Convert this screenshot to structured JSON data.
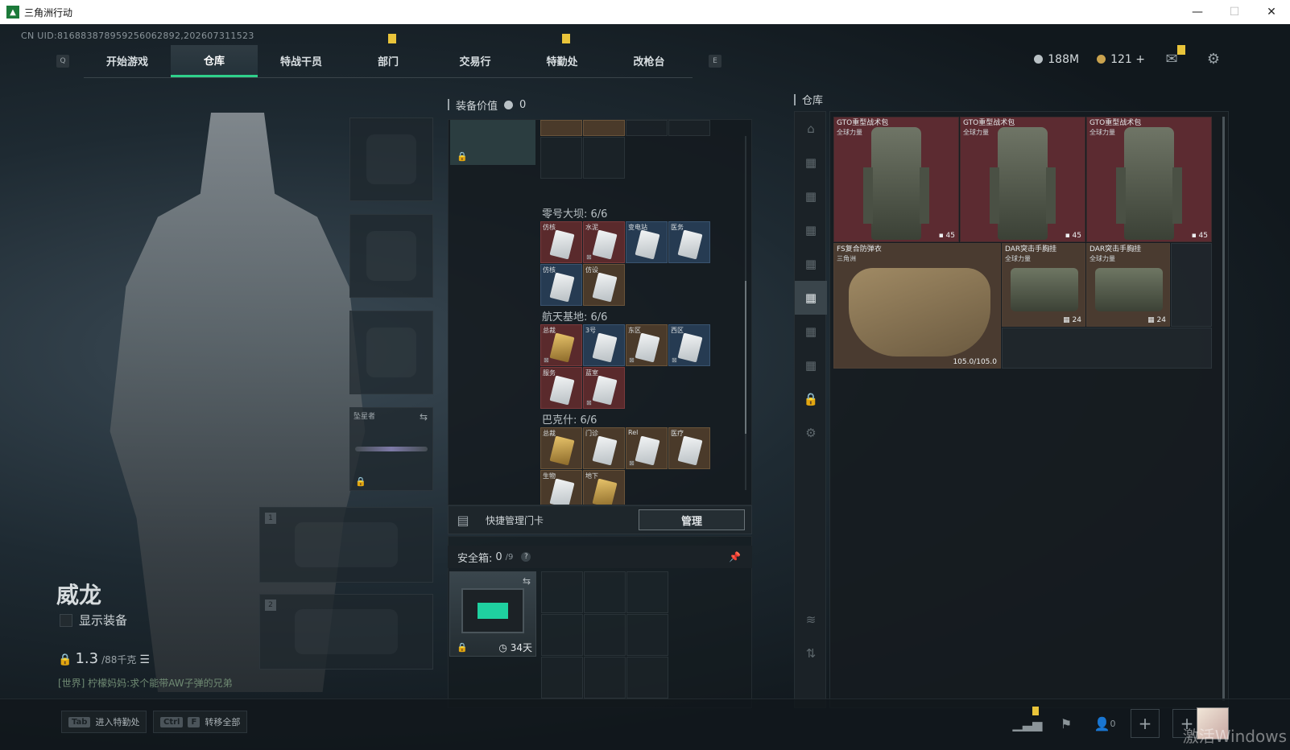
{
  "window": {
    "title": "三角洲行动",
    "minimize": "—",
    "maximize": "☐",
    "close": "✕"
  },
  "uid": "CN UID:816883878959256062892,202607311523",
  "nav": {
    "left_key": "Q",
    "right_key": "E",
    "tabs": [
      {
        "label": "开始游戏"
      },
      {
        "label": "仓库"
      },
      {
        "label": "特战干员"
      },
      {
        "label": "部门"
      },
      {
        "label": "交易行"
      },
      {
        "label": "特勤处"
      },
      {
        "label": "改枪台"
      }
    ]
  },
  "currency": {
    "silver": "188M",
    "gold": "121",
    "gold_plus": "+"
  },
  "operator": {
    "name": "威龙",
    "show_equipment": "显示装备",
    "weight": "1.3",
    "weight_cap": "/88千克",
    "world_chat": "[世界] 柠檬妈妈:求个能带AW子弹的兄弟"
  },
  "slots": {
    "melee_label": "坠星者",
    "primary_num": "1",
    "secondary_num": "2"
  },
  "mid": {
    "equip_value_label": "装备价值",
    "equip_value": "0",
    "sections": [
      {
        "title": "零号大坝: 6/6",
        "cards": [
          {
            "name": "仿核",
            "color": "red"
          },
          {
            "name": "水泥",
            "color": "red"
          },
          {
            "name": "变电站",
            "color": "blue"
          },
          {
            "name": "医务",
            "color": "blue"
          },
          {
            "name": "仿核",
            "color": "blue"
          },
          {
            "name": "仿设",
            "color": "brown"
          }
        ]
      },
      {
        "title": "航天基地: 6/6",
        "cards": [
          {
            "name": "总裁",
            "color": "red"
          },
          {
            "name": "3号",
            "color": "blue"
          },
          {
            "name": "东区",
            "color": "brown"
          },
          {
            "name": "西区",
            "color": "blue"
          },
          {
            "name": "服务",
            "color": "red"
          },
          {
            "name": "蓝室",
            "color": "red"
          }
        ]
      },
      {
        "title": "巴克什: 6/6",
        "cards": [
          {
            "name": "总裁",
            "color": "brown"
          },
          {
            "name": "门诊",
            "color": "brown"
          },
          {
            "name": "Rel",
            "color": "brown"
          },
          {
            "name": "医疗",
            "color": "brown"
          },
          {
            "name": "生物",
            "color": "brown"
          },
          {
            "name": "地下",
            "color": "brown"
          }
        ]
      }
    ],
    "quick_card_label": "快捷管理门卡",
    "manage_button": "管理",
    "safe_label": "安全箱:",
    "safe_count": "0",
    "safe_cap": "/9",
    "safe_help": "?",
    "safe_days": "34天"
  },
  "warehouse": {
    "title": "仓库",
    "items": [
      {
        "name": "GTO重型战术包",
        "sub": "全球力量",
        "count": "45",
        "kind": "pack"
      },
      {
        "name": "GTO重型战术包",
        "sub": "全球力量",
        "count": "45",
        "kind": "pack"
      },
      {
        "name": "GTO重型战术包",
        "sub": "全球力量",
        "count": "45",
        "kind": "pack"
      },
      {
        "name": "FS复合防弹衣",
        "sub": "三角洲",
        "count": "105.0/105.0",
        "kind": "armor"
      },
      {
        "name": "DAR突击手胸挂",
        "sub": "全球力量",
        "count": "24",
        "kind": "rig"
      },
      {
        "name": "DAR突击手胸挂",
        "sub": "全球力量",
        "count": "24",
        "kind": "rig"
      }
    ]
  },
  "bottom": {
    "hint1_key": "Tab",
    "hint1_label": "进入特勤处",
    "hint2_key1": "Ctrl",
    "hint2_key2": "F",
    "hint2_label": "转移全部",
    "friends": "0",
    "watermark": "激活Windows"
  }
}
